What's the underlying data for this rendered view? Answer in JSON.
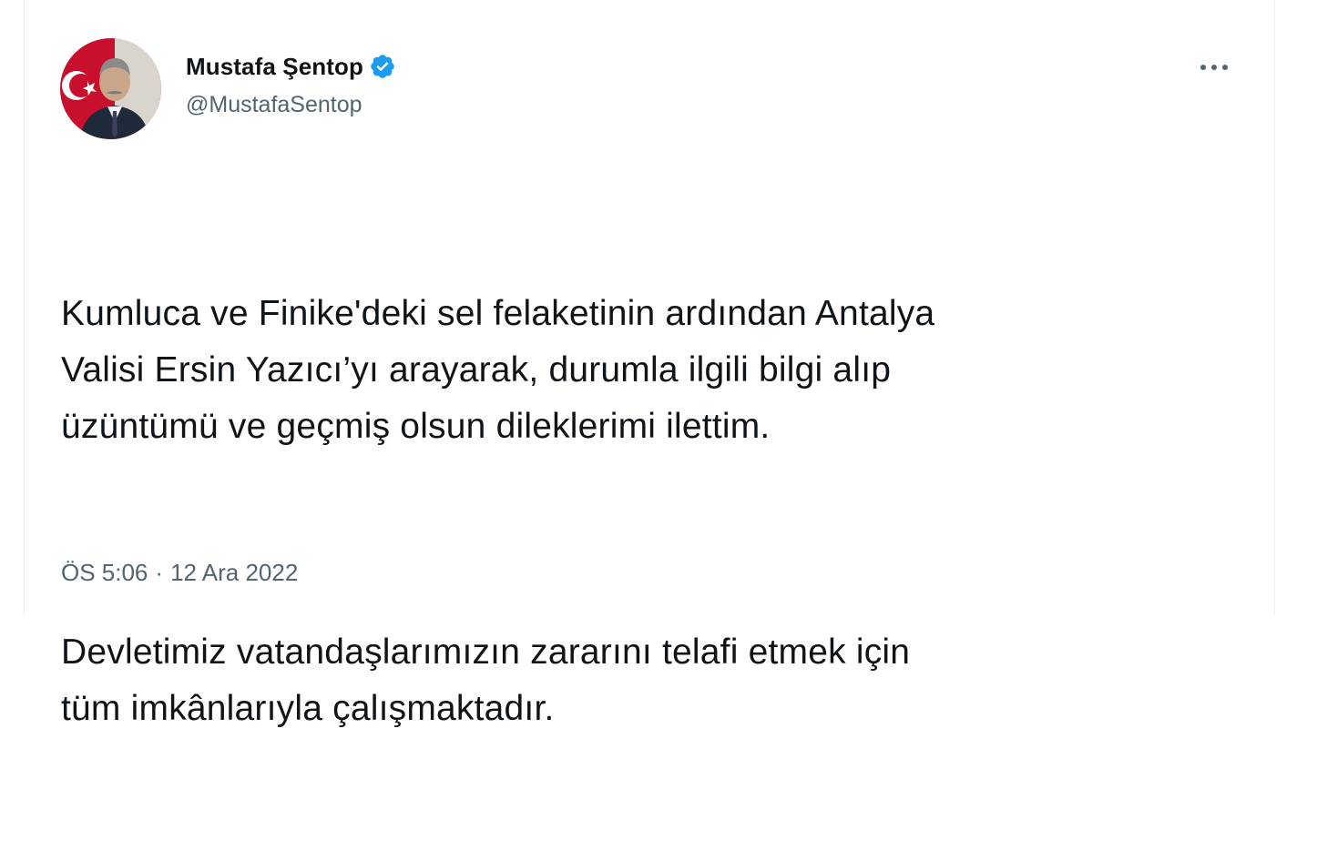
{
  "tweet": {
    "author": {
      "display_name": "Mustafa Şentop",
      "handle": "@MustafaSentop",
      "verified_icon": "verified-badge-icon",
      "avatar": "profile-photo"
    },
    "more_icon": "more-horizontal-icon",
    "paragraphs": [
      "Kumluca ve Finike'deki sel felaketinin ardından Antalya\nValisi Ersin Yazıcı’yı arayarak, durumla ilgili bilgi alıp\nüzüntümü ve geçmiş olsun dileklerimi ilettim.",
      "Devletimiz vatandaşlarımızın zararını telafi etmek için\ntüm imkânlarıyla çalışmaktadır."
    ],
    "timestamp": {
      "time": "ÖS 5:06",
      "separator": "·",
      "date": "12 Ara 2022"
    }
  },
  "colors": {
    "text_primary": "#0f1419",
    "text_secondary": "#536471",
    "verified_blue": "#1d9bf0",
    "border": "#e6ecf0"
  }
}
